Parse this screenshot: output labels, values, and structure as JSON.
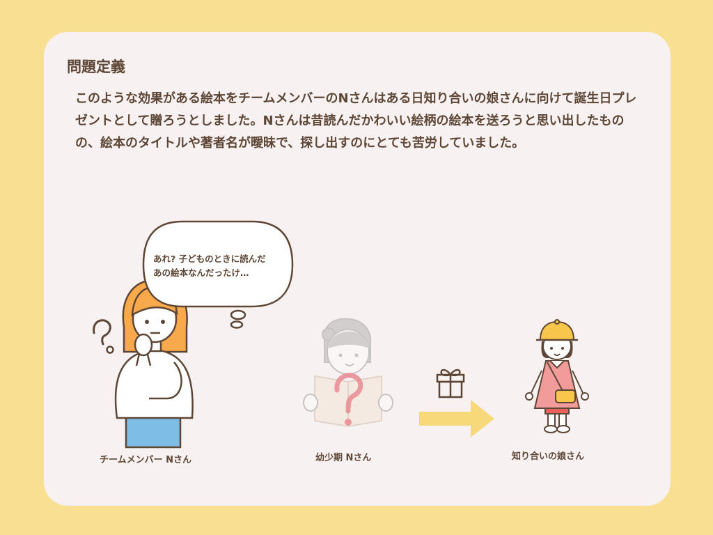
{
  "heading": "問題定義",
  "body_text": "このような効果がある絵本をチームメンバーのNさんはある日知り合いの娘さんに向けて誕生日プレゼントとして贈ろうとしました。Nさんは昔読んだかわいい絵柄の絵本を送ろうと思い出したものの、絵本のタイトルや著者名が曖昧で、探し出すのにとても苦労していました。",
  "speech_bubble": "あれ? 子どものときに読んだ\nあの絵本なんだったけ…",
  "captions": {
    "team_member": "チームメンバー Nさん",
    "child_n": "幼少期 Nさん",
    "daughter": "知り合いの娘さん"
  },
  "colors": {
    "background": "#f9df91",
    "card": "#f7f2f1",
    "text": "#5e4636",
    "arrow": "#f8d979",
    "question_mark": "#e47e87"
  },
  "icons": [
    "question-mark-icon",
    "gift-icon",
    "arrow-right-icon"
  ]
}
